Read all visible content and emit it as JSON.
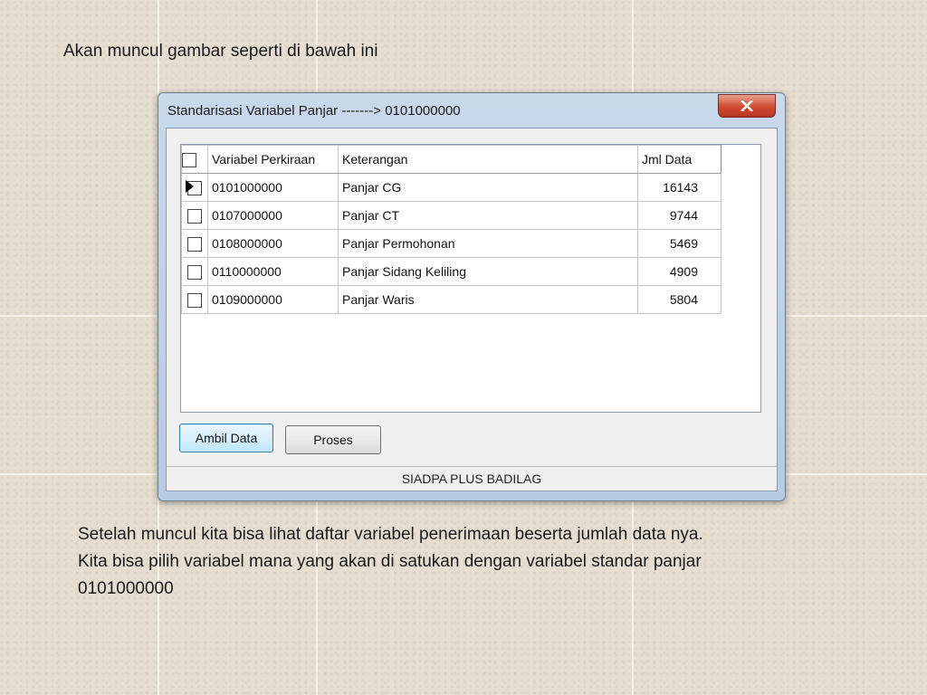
{
  "slide": {
    "intro_text": "Akan muncul gambar seperti di bawah ini",
    "description_lines": [
      "Setelah muncul kita bisa lihat daftar variabel penerimaan beserta jumlah data nya.",
      "Kita bisa pilih variabel mana yang akan di satukan dengan variabel standar panjar",
      "0101000000"
    ]
  },
  "dialog": {
    "title": "Standarisasi Variabel Panjar -------> 0101000000",
    "close_icon": "close-icon",
    "grid": {
      "columns": [
        "",
        "Variabel Perkiraan",
        "Keterangan",
        "Jml Data"
      ],
      "rows": [
        {
          "variabel": "0101000000",
          "keterangan": "Panjar CG",
          "jml": "16143",
          "current": true
        },
        {
          "variabel": "0107000000",
          "keterangan": "Panjar CT",
          "jml": "9744",
          "current": false
        },
        {
          "variabel": "0108000000",
          "keterangan": "Panjar Permohonan",
          "jml": "5469",
          "current": false
        },
        {
          "variabel": "0110000000",
          "keterangan": "Panjar Sidang Keliling",
          "jml": "4909",
          "current": false
        },
        {
          "variabel": "0109000000",
          "keterangan": "Panjar Waris",
          "jml": "5804",
          "current": false
        }
      ]
    },
    "buttons": {
      "ambil_data": "Ambil Data",
      "proses": "Proses"
    },
    "status_text": "SIADPA PLUS BADILAG"
  },
  "colors": {
    "close_button": "#c8432e",
    "window_frame": "#bcd0e6",
    "default_button_border": "#3c7fb1"
  }
}
